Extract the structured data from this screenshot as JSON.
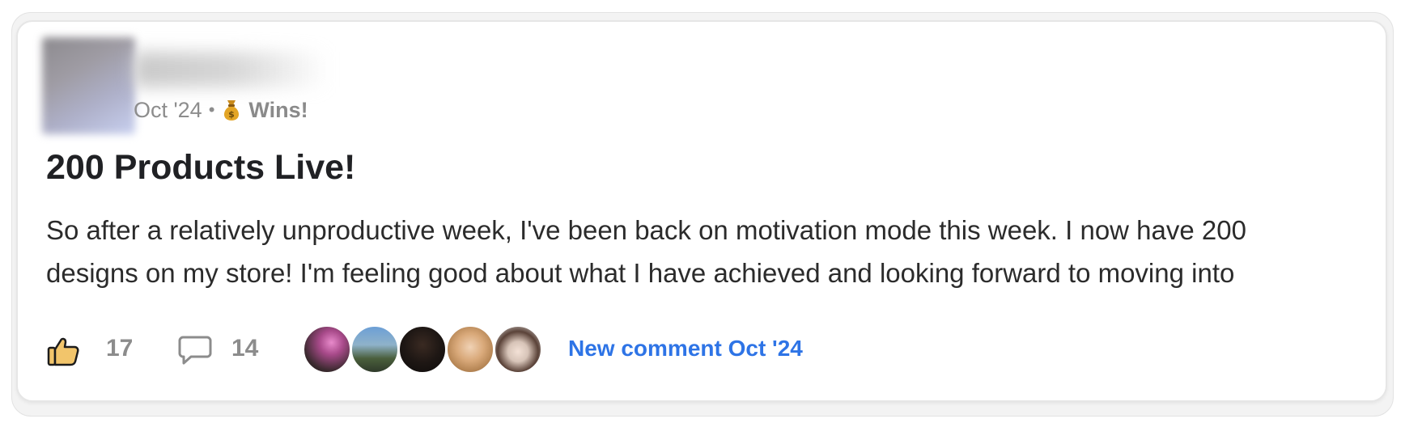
{
  "post": {
    "date": "Oct '24",
    "separator": "•",
    "category_icon": "money-bag-icon",
    "category": "Wins!",
    "title": "200 Products Live!",
    "body_lines": [
      "So after a relatively unproductive week, I've been back on motivation mode this week. I now have 200",
      "designs on my store! I'm feeling good about what I have achieved and looking forward to moving into"
    ]
  },
  "footer": {
    "like_icon": "thumbs-up-icon",
    "like_count": "17",
    "comment_icon": "comment-bubble-icon",
    "comment_count": "14",
    "new_comment_text": "New comment Oct '24"
  },
  "colors": {
    "link": "#2e74e6",
    "title": "#202124",
    "muted": "#8c8c8c",
    "like_fill": "#f2c56b"
  }
}
